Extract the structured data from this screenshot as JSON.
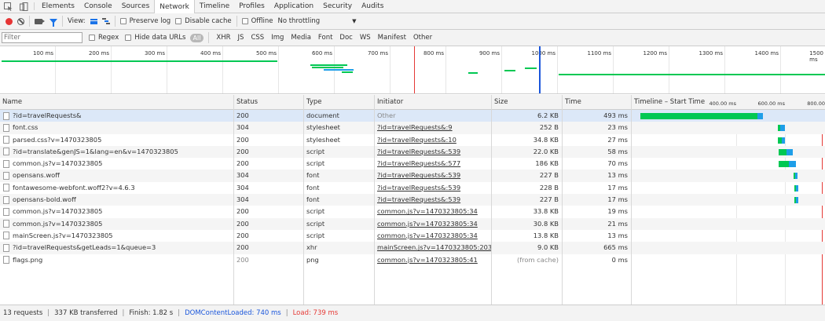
{
  "tabs": [
    "Elements",
    "Console",
    "Sources",
    "Network",
    "Timeline",
    "Profiles",
    "Application",
    "Security",
    "Audits"
  ],
  "active_tab": "Network",
  "toolbar": {
    "view_label": "View:",
    "preserve_log": "Preserve log",
    "disable_cache": "Disable cache",
    "offline": "Offline",
    "throttling": "No throttling"
  },
  "filter": {
    "placeholder": "Filter",
    "regex": "Regex",
    "hide_data_urls": "Hide data URLs",
    "all": "All",
    "types": [
      "XHR",
      "JS",
      "CSS",
      "Img",
      "Media",
      "Font",
      "Doc",
      "WS",
      "Manifest",
      "Other"
    ]
  },
  "overview_ticks": [
    "100 ms",
    "200 ms",
    "300 ms",
    "400 ms",
    "500 ms",
    "600 ms",
    "700 ms",
    "800 ms",
    "900 ms",
    "1000 ms",
    "1100 ms",
    "1200 ms",
    "1300 ms",
    "1400 ms",
    "1500 ms"
  ],
  "columns": {
    "name": "Name",
    "status": "Status",
    "type": "Type",
    "initiator": "Initiator",
    "size": "Size",
    "time": "Time",
    "timeline": "Timeline – Start Time"
  },
  "timeline_ticks": [
    "400.00 ms",
    "600.00 ms",
    "800.00"
  ],
  "requests": [
    {
      "name": "?id=travelRequests&",
      "status": "200",
      "type": "document",
      "initiator": "Other",
      "size": "6.2 KB",
      "time": "493 ms"
    },
    {
      "name": "font.css",
      "status": "304",
      "type": "stylesheet",
      "initiator": "?id=travelRequests&:9",
      "size": "252 B",
      "time": "23 ms"
    },
    {
      "name": "parsed.css?v=1470323805",
      "status": "200",
      "type": "stylesheet",
      "initiator": "?id=travelRequests&:10",
      "size": "34.8 KB",
      "time": "27 ms"
    },
    {
      "name": "?id=translate&genJS=1&lang=en&v=1470323805",
      "status": "200",
      "type": "script",
      "initiator": "?id=travelRequests&:539",
      "size": "22.0 KB",
      "time": "58 ms"
    },
    {
      "name": "common.js?v=1470323805",
      "status": "200",
      "type": "script",
      "initiator": "?id=travelRequests&:577",
      "size": "186 KB",
      "time": "70 ms"
    },
    {
      "name": "opensans.woff",
      "status": "304",
      "type": "font",
      "initiator": "?id=travelRequests&:539",
      "size": "227 B",
      "time": "13 ms"
    },
    {
      "name": "fontawesome-webfont.woff2?v=4.6.3",
      "status": "304",
      "type": "font",
      "initiator": "?id=travelRequests&:539",
      "size": "228 B",
      "time": "17 ms"
    },
    {
      "name": "opensans-bold.woff",
      "status": "304",
      "type": "font",
      "initiator": "?id=travelRequests&:539",
      "size": "227 B",
      "time": "17 ms"
    },
    {
      "name": "common.js?v=1470323805",
      "status": "200",
      "type": "script",
      "initiator": "common.js?v=1470323805:34",
      "size": "33.8 KB",
      "time": "19 ms"
    },
    {
      "name": "common.js?v=1470323805",
      "status": "200",
      "type": "script",
      "initiator": "common.js?v=1470323805:34",
      "size": "30.8 KB",
      "time": "21 ms"
    },
    {
      "name": "mainScreen.js?v=1470323805",
      "status": "200",
      "type": "script",
      "initiator": "common.js?v=1470323805:34",
      "size": "13.8 KB",
      "time": "13 ms"
    },
    {
      "name": "?id=travelRequests&getLeads=1&queue=3",
      "status": "200",
      "type": "xhr",
      "initiator": "mainScreen.js?v=1470323805:2037",
      "size": "9.0 KB",
      "time": "665 ms"
    },
    {
      "name": "flags.png",
      "status": "200",
      "type": "png",
      "initiator": "common.js?v=1470323805:41",
      "size": "(from cache)",
      "time": "0 ms"
    }
  ],
  "status": {
    "requests": "13 requests",
    "transferred": "337 KB transferred",
    "finish": "Finish: 1.82 s",
    "dom_content_loaded": "DOMContentLoaded: 740 ms",
    "load": "Load: 739 ms"
  },
  "colors": {
    "accent": "#1a73e8",
    "waiting": "#00c853",
    "receiving": "#1e9ee8",
    "load_line": "#e53935",
    "dcl_line": "#1a56db"
  }
}
